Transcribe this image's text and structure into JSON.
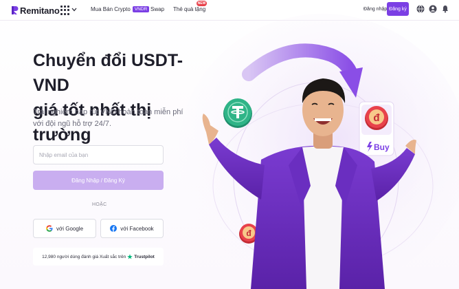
{
  "header": {
    "logo_text": "Remitano",
    "nav": {
      "buy_label": "Mua Bán Crypto",
      "buy_badge": "VNDR",
      "swap_label": "Swap",
      "gift_label": "Thẻ quà tặng",
      "gift_badge": "NEW"
    },
    "login_label": "Đăng nhập",
    "signup_label": "Đăng ký"
  },
  "hero": {
    "title_line1": "Chuyển đổi USDT-VND",
    "title_line2": "giá tốt nhất thị trường",
    "subtitle": "Trải nghiệm nạp rút VND hoàn toàn miễn phí với đội ngũ hỗ trợ 24/7.",
    "buy_card_label": "Buy"
  },
  "form": {
    "email_placeholder": "Nhập email của bạn",
    "submit_label": "Đăng Nhập / Đăng Ký",
    "or_label": "HOẶC",
    "google_label": "với Google",
    "facebook_label": "với Facebook"
  },
  "trust": {
    "text": "12,980 người dùng đánh giá Xuất sắc trên",
    "brand": "Trustpilot"
  },
  "colors": {
    "brand": "#7b3fe4",
    "button_disabled": "#c9aef0",
    "tether": "#26a17b",
    "vndr": "#e8424b",
    "bitcoin": "#f7931a"
  },
  "icons": [
    "apps-grid-icon",
    "chevron-down-icon",
    "globe-icon",
    "user-icon",
    "bell-icon",
    "google-icon",
    "facebook-icon",
    "trustpilot-star-icon",
    "tether-coin-icon",
    "vndr-coin-icon",
    "bitcoin-coin-icon",
    "lightning-icon"
  ]
}
